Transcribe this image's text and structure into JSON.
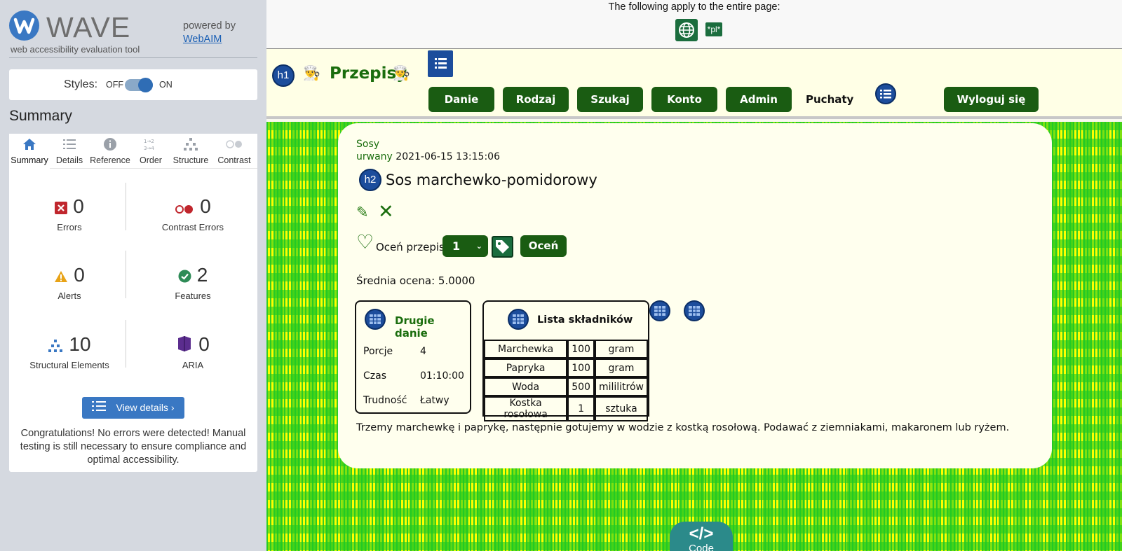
{
  "wave": {
    "title": "WAVE",
    "subtitle": "web accessibility evaluation tool",
    "powered_by": "powered by",
    "webaim_link": "WebAIM",
    "styles": {
      "label": "Styles:",
      "off": "OFF",
      "on": "ON",
      "state": "on"
    },
    "summary_heading": "Summary",
    "tabs": [
      {
        "label": "Summary",
        "icon": "home-icon",
        "active": true
      },
      {
        "label": "Details",
        "icon": "list-icon"
      },
      {
        "label": "Reference",
        "icon": "info-icon"
      },
      {
        "label": "Order",
        "icon": "order-icon"
      },
      {
        "label": "Structure",
        "icon": "structure-icon"
      },
      {
        "label": "Contrast",
        "icon": "contrast-icon"
      }
    ],
    "stats": {
      "errors": {
        "count": "0",
        "label": "Errors"
      },
      "contrast_errors": {
        "count": "0",
        "label": "Contrast Errors"
      },
      "alerts": {
        "count": "0",
        "label": "Alerts"
      },
      "features": {
        "count": "2",
        "label": "Features"
      },
      "structural": {
        "count": "10",
        "label": "Structural Elements"
      },
      "aria": {
        "count": "0",
        "label": "ARIA"
      }
    },
    "view_details": "View details ›",
    "congrats": "Congratulations! No errors were detected! Manual testing is still necessary to ensure compliance and optimal accessibility.",
    "colors": {
      "accent": "#3a78c3",
      "error": "#c0262d",
      "alert": "#e8a317",
      "feature": "#2e8b57",
      "aria": "#5b2d8e"
    }
  },
  "page": {
    "applies_text": "The following apply to the entire page:",
    "lang_badge": "*pl*",
    "site_title": "Przepisy",
    "nav": [
      "Danie",
      "Rodzaj",
      "Szukaj",
      "Konto",
      "Admin"
    ],
    "nav_current": "Puchaty",
    "logout": "Wyloguj się",
    "recipe": {
      "category": "Sosy",
      "author": "urwany",
      "date": "2021-06-15 13:15:06",
      "title": "Sos marchewko-pomidorowy",
      "rate_label": "Oceń przepis",
      "rate_value": "1",
      "rate_button": "Oceń",
      "average": "Średnia ocena: 5.0000",
      "info_title": "Drugie danie",
      "info": [
        {
          "k": "Porcje",
          "v": "4"
        },
        {
          "k": "Czas",
          "v": "01:10:00"
        },
        {
          "k": "Trudność",
          "v": "Łatwy"
        }
      ],
      "ingredients_title": "Lista składników",
      "ingredients": [
        [
          "Marchewka",
          "100",
          "gram"
        ],
        [
          "Papryka",
          "100",
          "gram"
        ],
        [
          "Woda",
          "500",
          "mililitrów"
        ],
        [
          "Kostka rosołowa",
          "1",
          "sztuka"
        ]
      ],
      "description": "Trzemy marchewkę i paprykę, następnie gotujemy w wodzie z kostką rosołową. Podawać z ziemniakami, makaronem lub ryżem."
    },
    "h1_badge": "h1",
    "h2_badge": "h2",
    "code_tab": "Code",
    "code_icon": "</>",
    "colors": {
      "brand_green": "#1a5c12",
      "badge_blue": "#1c4d9c",
      "card_bg": "#ffffee"
    }
  }
}
